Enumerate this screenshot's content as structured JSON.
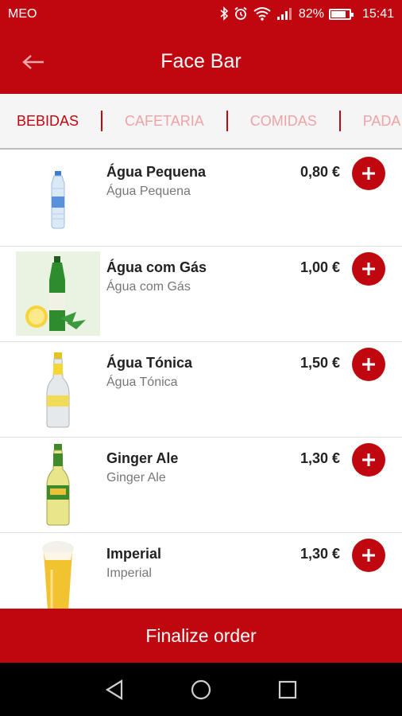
{
  "status_bar": {
    "carrier": "MEO",
    "battery": "82%",
    "battery_level": 0.82,
    "time": "15:41",
    "icons": [
      "bluetooth-icon",
      "alarm-icon",
      "wifi-icon",
      "signal-icon",
      "battery-icon"
    ]
  },
  "app_bar": {
    "title": "Face Bar",
    "back_icon": "arrow-left-icon"
  },
  "tabs": [
    {
      "label": "BEBIDAS",
      "active": true
    },
    {
      "label": "CAFETARIA",
      "active": false
    },
    {
      "label": "COMIDAS",
      "active": false
    },
    {
      "label": "PADA",
      "active": false
    }
  ],
  "products": [
    {
      "name": "Água Pequena",
      "description": "Água Pequena",
      "price": "0,80 €",
      "image": "small-water-bottle"
    },
    {
      "name": "Água com Gás",
      "description": "Água com Gás",
      "price": "1,00 €",
      "image": "sparkling-water-bottle"
    },
    {
      "name": "Água Tónica",
      "description": "Água Tónica",
      "price": "1,50 €",
      "image": "tonic-water-bottle"
    },
    {
      "name": "Ginger Ale",
      "description": "Ginger Ale",
      "price": "1,30 €",
      "image": "ginger-ale-bottle"
    },
    {
      "name": "Imperial",
      "description": "Imperial",
      "price": "1,30 €",
      "image": "beer-glass"
    }
  ],
  "footer": {
    "finalize_label": "Finalize order"
  },
  "colors": {
    "primary": "#c0070f",
    "tab_inactive": "#f0a3a6",
    "text": "#222222",
    "subtext": "#777777"
  }
}
